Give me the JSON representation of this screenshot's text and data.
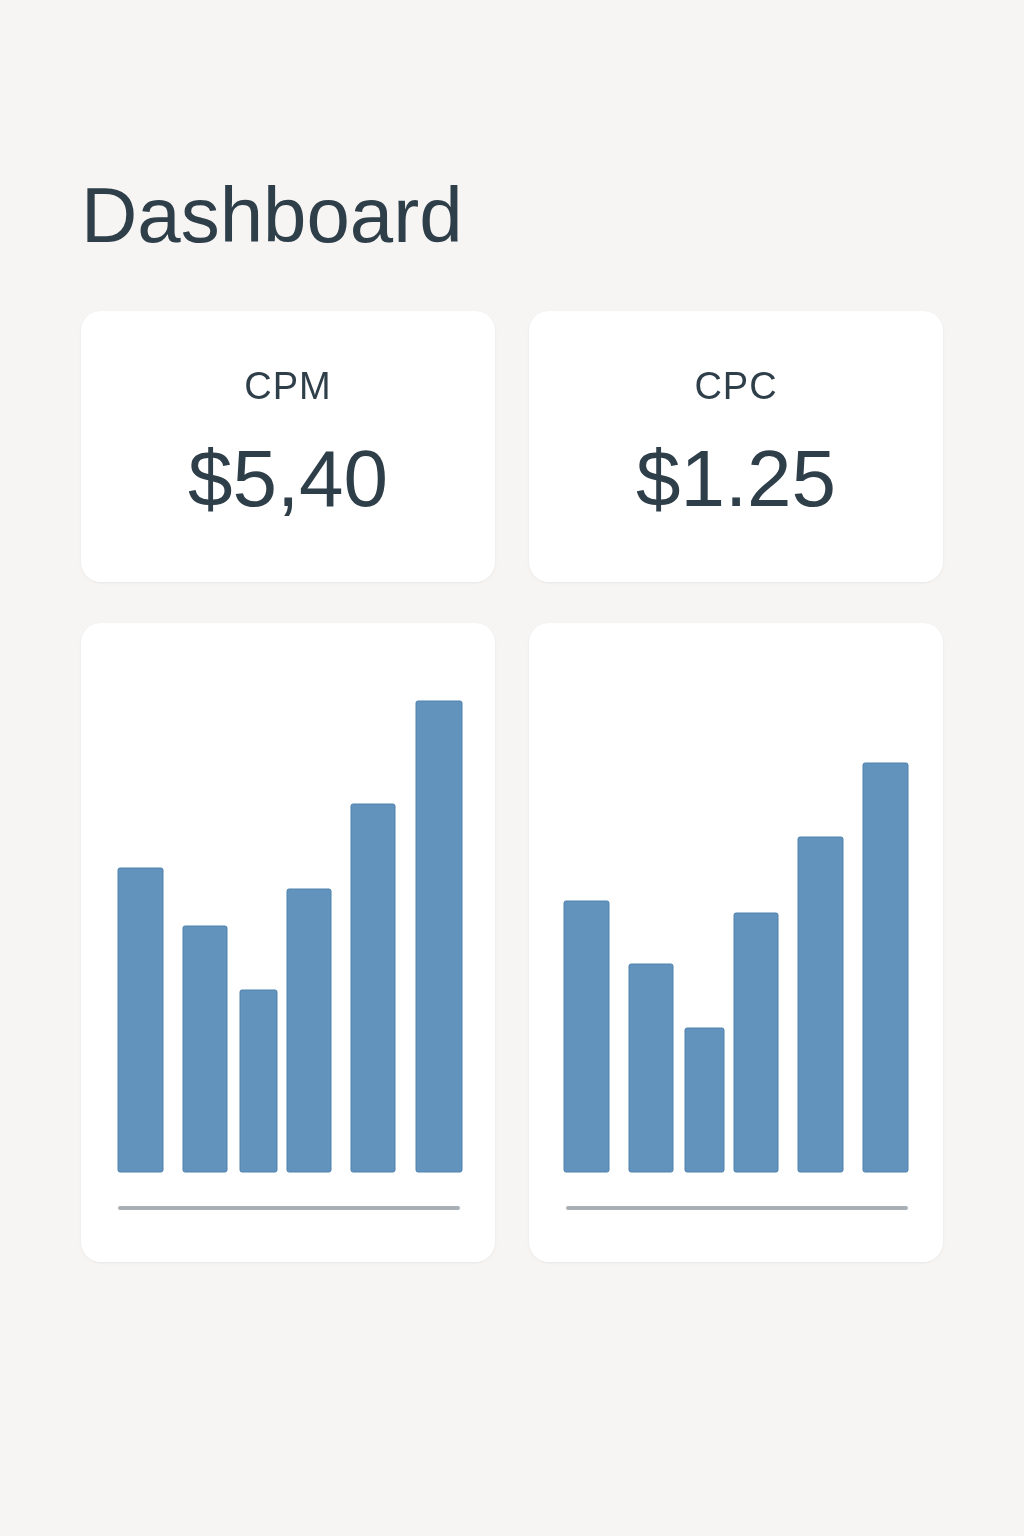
{
  "title": "Dashboard",
  "metrics": [
    {
      "label": "CPM",
      "value": "$5,40"
    },
    {
      "label": "CPC",
      "value": "$1.25"
    }
  ],
  "charts": [
    {
      "kind": "bar"
    },
    {
      "kind": "bar"
    }
  ]
}
